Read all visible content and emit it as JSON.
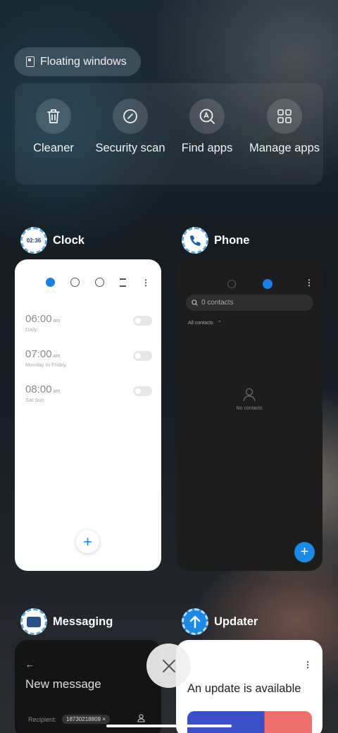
{
  "floating": {
    "label": "Floating windows"
  },
  "tools": [
    {
      "label": "Cleaner",
      "icon": "trash-icon"
    },
    {
      "label": "Security scan",
      "icon": "security-scan-icon"
    },
    {
      "label": "Find apps",
      "icon": "find-apps-icon"
    },
    {
      "label": "Manage apps",
      "icon": "manage-apps-icon"
    }
  ],
  "apps": {
    "clock": {
      "name": "Clock",
      "icon_text": "02:36",
      "alarms": [
        {
          "time": "06:00",
          "ampm": "am",
          "repeat": "Daily"
        },
        {
          "time": "07:00",
          "ampm": "am",
          "repeat": "Monday to Friday"
        },
        {
          "time": "08:00",
          "ampm": "am",
          "repeat": "Sat Sun"
        }
      ],
      "add_label": "+"
    },
    "phone": {
      "name": "Phone",
      "search_placeholder": "0 contacts",
      "filter_label": "All contacts",
      "empty_text": "No contacts",
      "add_label": "+"
    },
    "messaging": {
      "name": "Messaging",
      "title": "New message",
      "recipient_label": "Recipient:",
      "recipient_chip": "18730218809 ×"
    },
    "updater": {
      "name": "Updater",
      "title": "An update is available"
    }
  },
  "colors": {
    "accent": "#1a80e6",
    "phone_bg": "#1d1d1d",
    "card_white": "#ffffff"
  }
}
